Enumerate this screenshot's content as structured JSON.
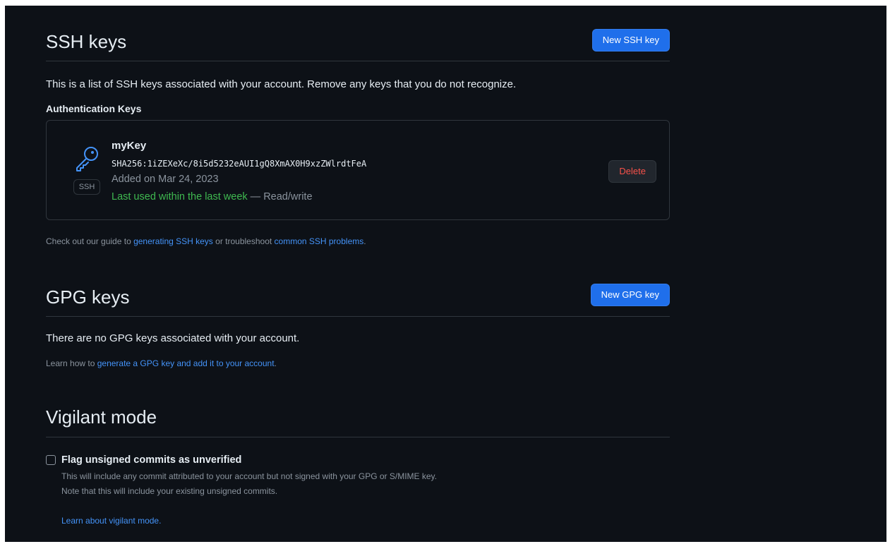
{
  "ssh": {
    "title": "SSH keys",
    "new_button": "New SSH key",
    "description": "This is a list of SSH keys associated with your account. Remove any keys that you do not recognize.",
    "auth_heading": "Authentication Keys",
    "keys": [
      {
        "name": "myKey",
        "fingerprint": "SHA256:1iZEXeXc/8i5d5232eAUI1gQ8XmAX0H9xzZWlrdtFeA",
        "added": "Added on Mar 24, 2023",
        "last_used": "Last used within the last week",
        "access": "— Read/write",
        "type_badge": "SSH",
        "delete_label": "Delete"
      }
    ],
    "guide": {
      "prefix": "Check out our guide to ",
      "link1": "generating SSH keys",
      "middle": " or troubleshoot ",
      "link2": "common SSH problems",
      "suffix": "."
    }
  },
  "gpg": {
    "title": "GPG keys",
    "new_button": "New GPG key",
    "empty_text": "There are no GPG keys associated with your account.",
    "learn": {
      "prefix": "Learn how to ",
      "link": "generate a GPG key and add it to your account",
      "suffix": "."
    }
  },
  "vigilant": {
    "title": "Vigilant mode",
    "checkbox_label": "Flag unsigned commits as unverified",
    "checked": false,
    "desc1": "This will include any commit attributed to your account but not signed with your GPG or S/MIME key.",
    "desc2": "Note that this will include your existing unsigned commits.",
    "learn_link": "Learn about vigilant mode."
  },
  "colors": {
    "background": "#0d1117",
    "border": "#30363d",
    "primary_button": "#1f6feb",
    "link": "#4493f8",
    "success": "#3fb950",
    "danger": "#f85149",
    "muted": "#8b949e"
  },
  "icons": {
    "key": "key-icon"
  }
}
